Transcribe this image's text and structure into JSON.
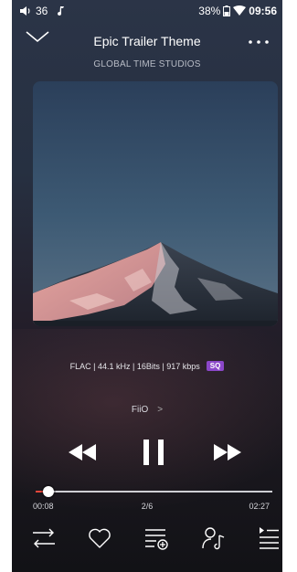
{
  "status_bar": {
    "volume": "36",
    "battery": "38%",
    "time": "09:56",
    "icons": [
      "speaker-icon",
      "music-note-icon",
      "battery-icon",
      "wifi-icon"
    ]
  },
  "header": {
    "title": "Epic Trailer Theme",
    "artist": "GLOBAL TIME STUDIOS",
    "icons": [
      "chevron-down-icon",
      "more-dots-icon"
    ]
  },
  "album_art": {
    "description": "album-cover-mountain"
  },
  "audio": {
    "format": "FLAC | 44.1 kHz | 16Bits | 917 kbps",
    "badge": "SQ",
    "badge_color": "#8b47c9"
  },
  "output": {
    "device": "FiiO",
    "chevron": ">"
  },
  "playback": {
    "current_time": "00:08",
    "total_time": "02:27",
    "track_position": "2/6",
    "progress_fraction": 0.054,
    "progress_color": "#e8463a",
    "icons": [
      "previous-icon",
      "pause-icon",
      "next-icon"
    ]
  },
  "bottom_bar": {
    "icons": [
      "shuffle-order-icon",
      "heart-icon",
      "add-to-playlist-icon",
      "lyrics-icon",
      "queue-icon"
    ]
  }
}
